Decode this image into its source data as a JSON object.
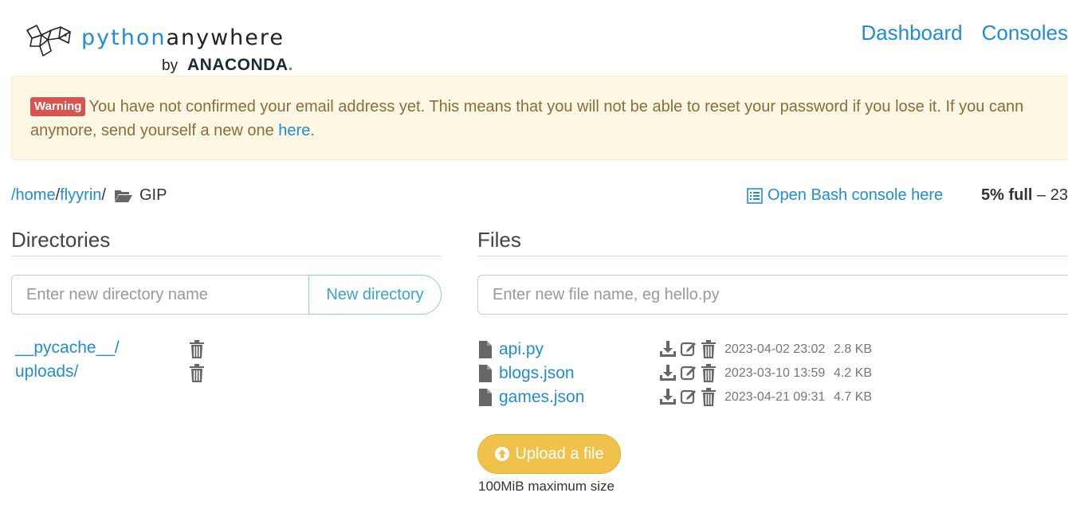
{
  "logo": {
    "brand_part1": "python",
    "brand_part2": "anywhere",
    "by": "by",
    "anaconda": "ANACONDA",
    "anaconda_dot": "."
  },
  "nav": {
    "dashboard": "Dashboard",
    "consoles": "Consoles"
  },
  "warning": {
    "badge": "Warning",
    "text1": "You have not confirmed your email address yet. This means that you will not be able to reset your password if you lose it. If you cann",
    "text2": "anymore, send yourself a new one ",
    "link": "here",
    "text3": "."
  },
  "breadcrumb": {
    "home": "/home",
    "sep1": "/",
    "user": "flyyrin",
    "sep2": "/",
    "current": "GIP"
  },
  "bash": {
    "label": "Open Bash console here"
  },
  "usage": {
    "percent": "5% full",
    "rest": " – 23"
  },
  "directories": {
    "title": "Directories",
    "input_placeholder": "Enter new directory name",
    "button": "New directory",
    "items": [
      {
        "name": "__pycache__/"
      },
      {
        "name": "uploads/"
      }
    ]
  },
  "files": {
    "title": "Files",
    "input_placeholder": "Enter new file name, eg hello.py",
    "items": [
      {
        "name": "api.py",
        "date": "2023-04-02 23:02",
        "size": "2.8 KB"
      },
      {
        "name": "blogs.json",
        "date": "2023-03-10 13:59",
        "size": "4.2 KB"
      },
      {
        "name": "games.json",
        "date": "2023-04-21 09:31",
        "size": "4.7 KB"
      }
    ],
    "upload_button": "Upload a file",
    "upload_note": "100MiB maximum size"
  }
}
